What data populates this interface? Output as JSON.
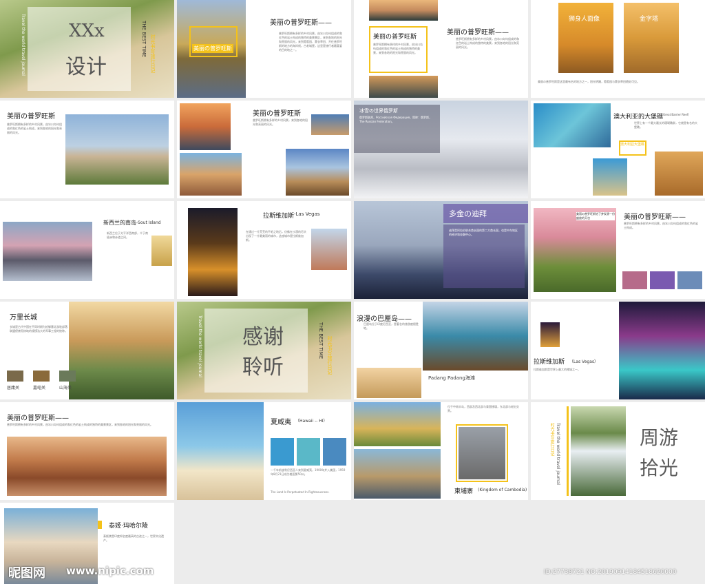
{
  "cover": {
    "title": "XXx设计",
    "title_latin": "XXx",
    "title_cn": "设计",
    "vert_en": "Travel the world travel journal",
    "vert_best": "THE BEST TIME",
    "vert_cn": "时光书写旅行日记"
  },
  "thanks": {
    "line1": "感谢",
    "line2": "聆听",
    "vert_en": "Travel the world travel journal",
    "vert_best": "THE BEST TIME",
    "vert_cn": "时光书写旅行日记"
  },
  "slides": {
    "s2": {
      "title": "美丽の普罗旺斯——",
      "caption": "美丽の普罗旺斯",
      "body": "普罗旺斯拥有多样的乡村风景，由冰川岛屿组成的和红色的岩土构成的独特的美景景区，来到各地的阳光和亮丽的风光，来到葡萄园、薰衣草田、开往普罗旺斯的地方的海岸线，古老城堡，这里是旅行者最喜爱的目的地之一。"
    },
    "s3": {
      "title": "美丽の普罗旺斯——",
      "caption": "美丽の普罗旺斯",
      "body": "普罗旺斯拥有多样的乡村风景，由冰川岛屿组成的和红色的岩土构成的独特的美景，来到各地的阳光和亮丽的风光。"
    },
    "s4": {
      "label1": "狮身人面像",
      "label2": "金字塔",
      "body": "美丽の普罗旺斯是这里最有名的地方之一，阳光明媚，葡萄园与薰衣草田随处可见。"
    },
    "s5": {
      "title": "美丽の普罗旺斯",
      "body": "普罗旺斯拥有多样的乡村风景，由冰川岛屿组成的和红色的岩土构成，来到各地的阳光和亮丽的风光。"
    },
    "s6": {
      "title": "美丽の普罗旺斯",
      "body": "普罗旺斯拥有多样的乡村风景，来到各地的阳光和亮丽的风光。"
    },
    "s7": {
      "title": "冰雪の世界俄罗斯",
      "body": "俄罗斯联邦，Российская Федерация，简称：俄罗斯，The Russian Federation。"
    },
    "s8": {
      "title": "澳大利亚的大堡礁",
      "subtitle": "（Great Barrier Reef）",
      "caption": "澳大利亚大堡礁",
      "caption2": "Great Barrier Reef",
      "body": "世界上有一个最大最长的珊瑚礁群，它就是有名的大堡礁。"
    },
    "s9": {
      "title": "新西兰的南岛",
      "title_en": "-Sout Island",
      "body": "新西兰位于太平洋西南部，介于南极洲和赤道之间。"
    },
    "s10": {
      "title": "拉斯维加斯",
      "title_en": "-Las Vegas",
      "body": "在通过一片荒芜的不毛之地后，仿佛在沙漠的尽头出现了一片最美丽的城市，这座城市是拉斯维加斯。"
    },
    "s11": {
      "title": "多金の迪拜",
      "body": "迪拜是阿拉伯联合酋长国的第二大酋长国，也是中东地区的经济和金融中心。"
    },
    "s12": {
      "title": "美丽の普罗旺斯——",
      "caption": "美丽の普罗旺斯给了梦发源一份盛放的天也",
      "body": "普罗旺斯拥有多样的乡村风景，由冰川岛屿组成的和红色的岩土构成。"
    },
    "s13": {
      "title": "万里长城",
      "body": "长城是古代中国在不同时期为抵御塞北游牧部落联盟侵袭而修筑的规模浩大的军事工程的统称。",
      "labels": [
        "居庸关",
        "嘉峪关",
        "山海关"
      ]
    },
    "s15": {
      "title": "浪漫の巴厘岛——",
      "caption": "Padang Padang海滩",
      "body": "巴厘岛位于印度尼西亚，是著名的旅游度假胜地。"
    },
    "s16": {
      "title": "拉斯维加斯",
      "title_en": "（Las Vegas）",
      "body": "拉斯维加斯是世界上最大的赌城之一。"
    },
    "s17": {
      "title": "美丽の普罗旺斯——",
      "body": "普罗旺斯拥有多样的乡村风景，由冰川岛屿组成的和红色的岩土构成的独特的美景景区，来到各地的阳光和亮丽的风光。"
    },
    "s18": {
      "title": "夏威夷",
      "title_en": "（Hawaii -- HI）",
      "body": "一千年前波利尼西亚人来到夏威夷，1900年并入美国，1959年8月21日成为美国第50州。",
      "quote": "The Land Is Perpetuated In Righteousness."
    },
    "s19": {
      "title": "柬埔寨",
      "title_en": "(Kingdom of Cambodia)",
      "body": "位于中南半岛，西部及西北部与泰国接壤，东北部与老挝交界。"
    },
    "s20": {
      "title_line1": "周游",
      "title_line2": "拾光",
      "vert_en": "Travel the world travel journal",
      "vert_cn": "时光书写旅行日记"
    },
    "s21": {
      "title": "泰姬·玛哈尔陵",
      "body": "泰姬陵是印度知名度最高的古迹之一，世界文化遗产。"
    }
  },
  "watermark": {
    "logo": "昵图网",
    "url": "www.nipic.com",
    "id": "ID:27738721 NO:20190914184518620000"
  }
}
